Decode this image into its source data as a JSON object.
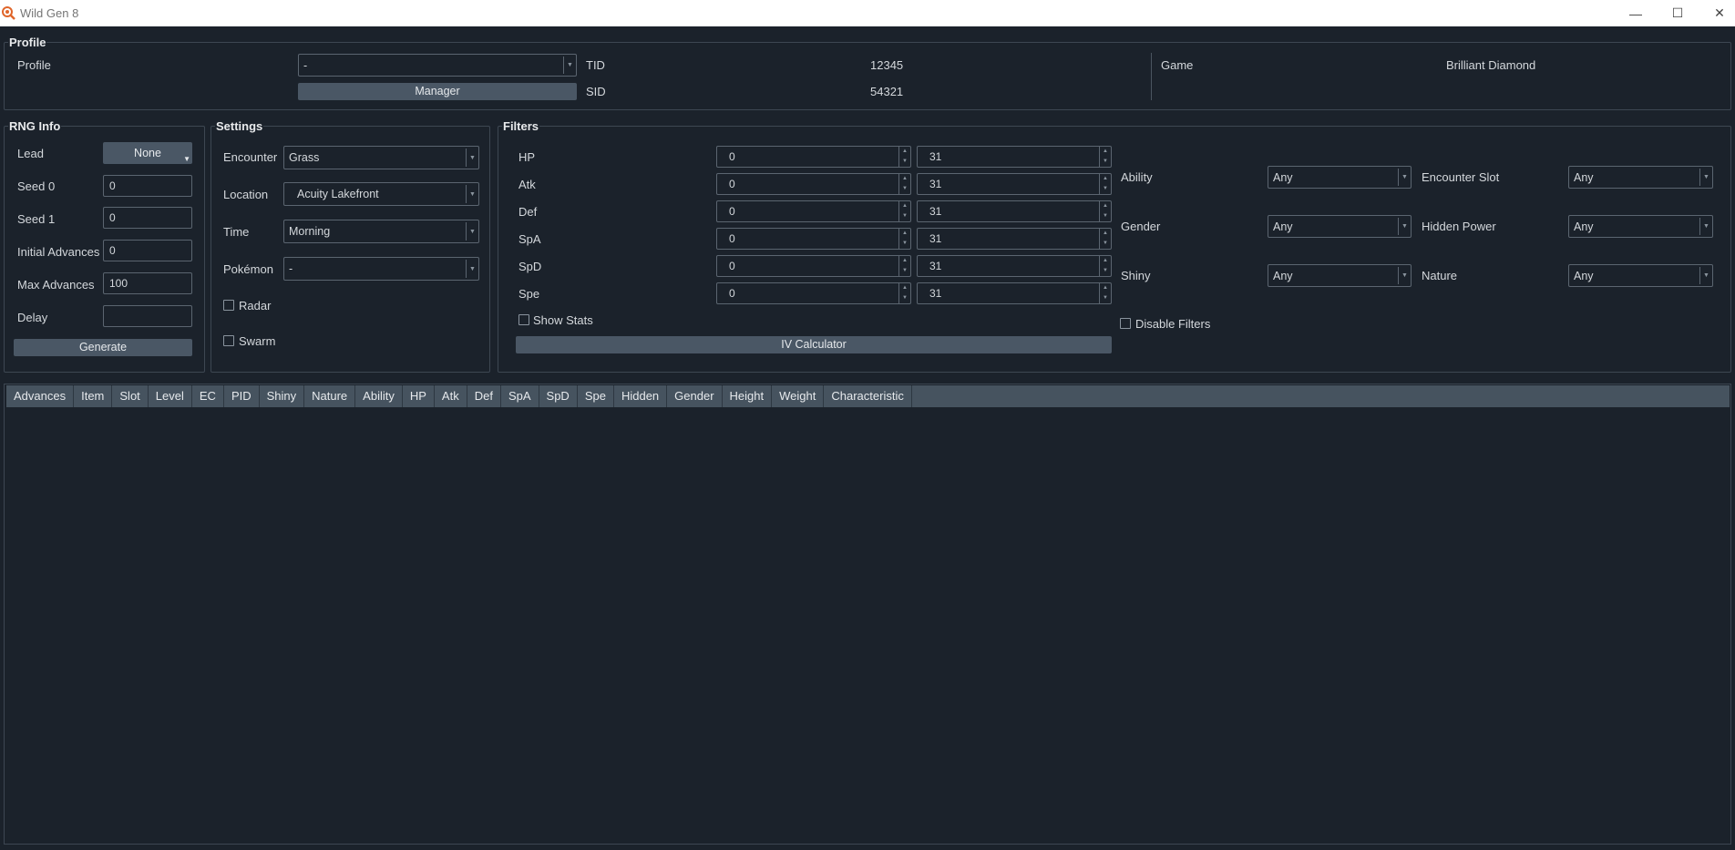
{
  "window": {
    "title": "Wild Gen 8",
    "minimize_icon": "minimize-icon",
    "maximize_icon": "maximize-icon",
    "close_icon": "close-icon"
  },
  "profile": {
    "group_title": "Profile",
    "profile_label": "Profile",
    "profile_value": "-",
    "manager_label": "Manager",
    "tid_label": "TID",
    "tid_value": "12345",
    "sid_label": "SID",
    "sid_value": "54321",
    "game_label": "Game",
    "game_value": "Brilliant Diamond"
  },
  "rng_info": {
    "group_title": "RNG Info",
    "lead_label": "Lead",
    "lead_value": "None",
    "seed0_label": "Seed 0",
    "seed0_value": "0",
    "seed1_label": "Seed 1",
    "seed1_value": "0",
    "initial_label": "Initial Advances",
    "initial_value": "0",
    "max_label": "Max Advances",
    "max_value": "100",
    "delay_label": "Delay",
    "delay_value": "",
    "generate_label": "Generate"
  },
  "settings": {
    "group_title": "Settings",
    "encounter_label": "Encounter",
    "encounter_value": "Grass",
    "location_label": "Location",
    "location_value": "Acuity Lakefront",
    "time_label": "Time",
    "time_value": "Morning",
    "pokemon_label": "Pokémon",
    "pokemon_value": "-",
    "radar_label": "Radar",
    "swarm_label": "Swarm"
  },
  "filters": {
    "group_title": "Filters",
    "ivs": [
      {
        "stat": "HP",
        "min": "0",
        "max": "31"
      },
      {
        "stat": "Atk",
        "min": "0",
        "max": "31"
      },
      {
        "stat": "Def",
        "min": "0",
        "max": "31"
      },
      {
        "stat": "SpA",
        "min": "0",
        "max": "31"
      },
      {
        "stat": "SpD",
        "min": "0",
        "max": "31"
      },
      {
        "stat": "Spe",
        "min": "0",
        "max": "31"
      }
    ],
    "show_stats_label": "Show Stats",
    "iv_calculator_label": "IV Calculator",
    "ability_label": "Ability",
    "ability_value": "Any",
    "gender_label": "Gender",
    "gender_value": "Any",
    "shiny_label": "Shiny",
    "shiny_value": "Any",
    "encounter_slot_label": "Encounter Slot",
    "encounter_slot_value": "Any",
    "hidden_power_label": "Hidden Power",
    "hidden_power_value": "Any",
    "nature_label": "Nature",
    "nature_value": "Any",
    "disable_filters_label": "Disable Filters"
  },
  "results": {
    "columns": [
      "Advances",
      "Item",
      "Slot",
      "Level",
      "EC",
      "PID",
      "Shiny",
      "Nature",
      "Ability",
      "HP",
      "Atk",
      "Def",
      "SpA",
      "SpD",
      "Spe",
      "Hidden",
      "Gender",
      "Height",
      "Weight",
      "Characteristic"
    ],
    "rows": []
  },
  "colors": {
    "background": "#1b222b",
    "button": "#4a5765",
    "header": "#46535f",
    "border": "#5b6570"
  }
}
